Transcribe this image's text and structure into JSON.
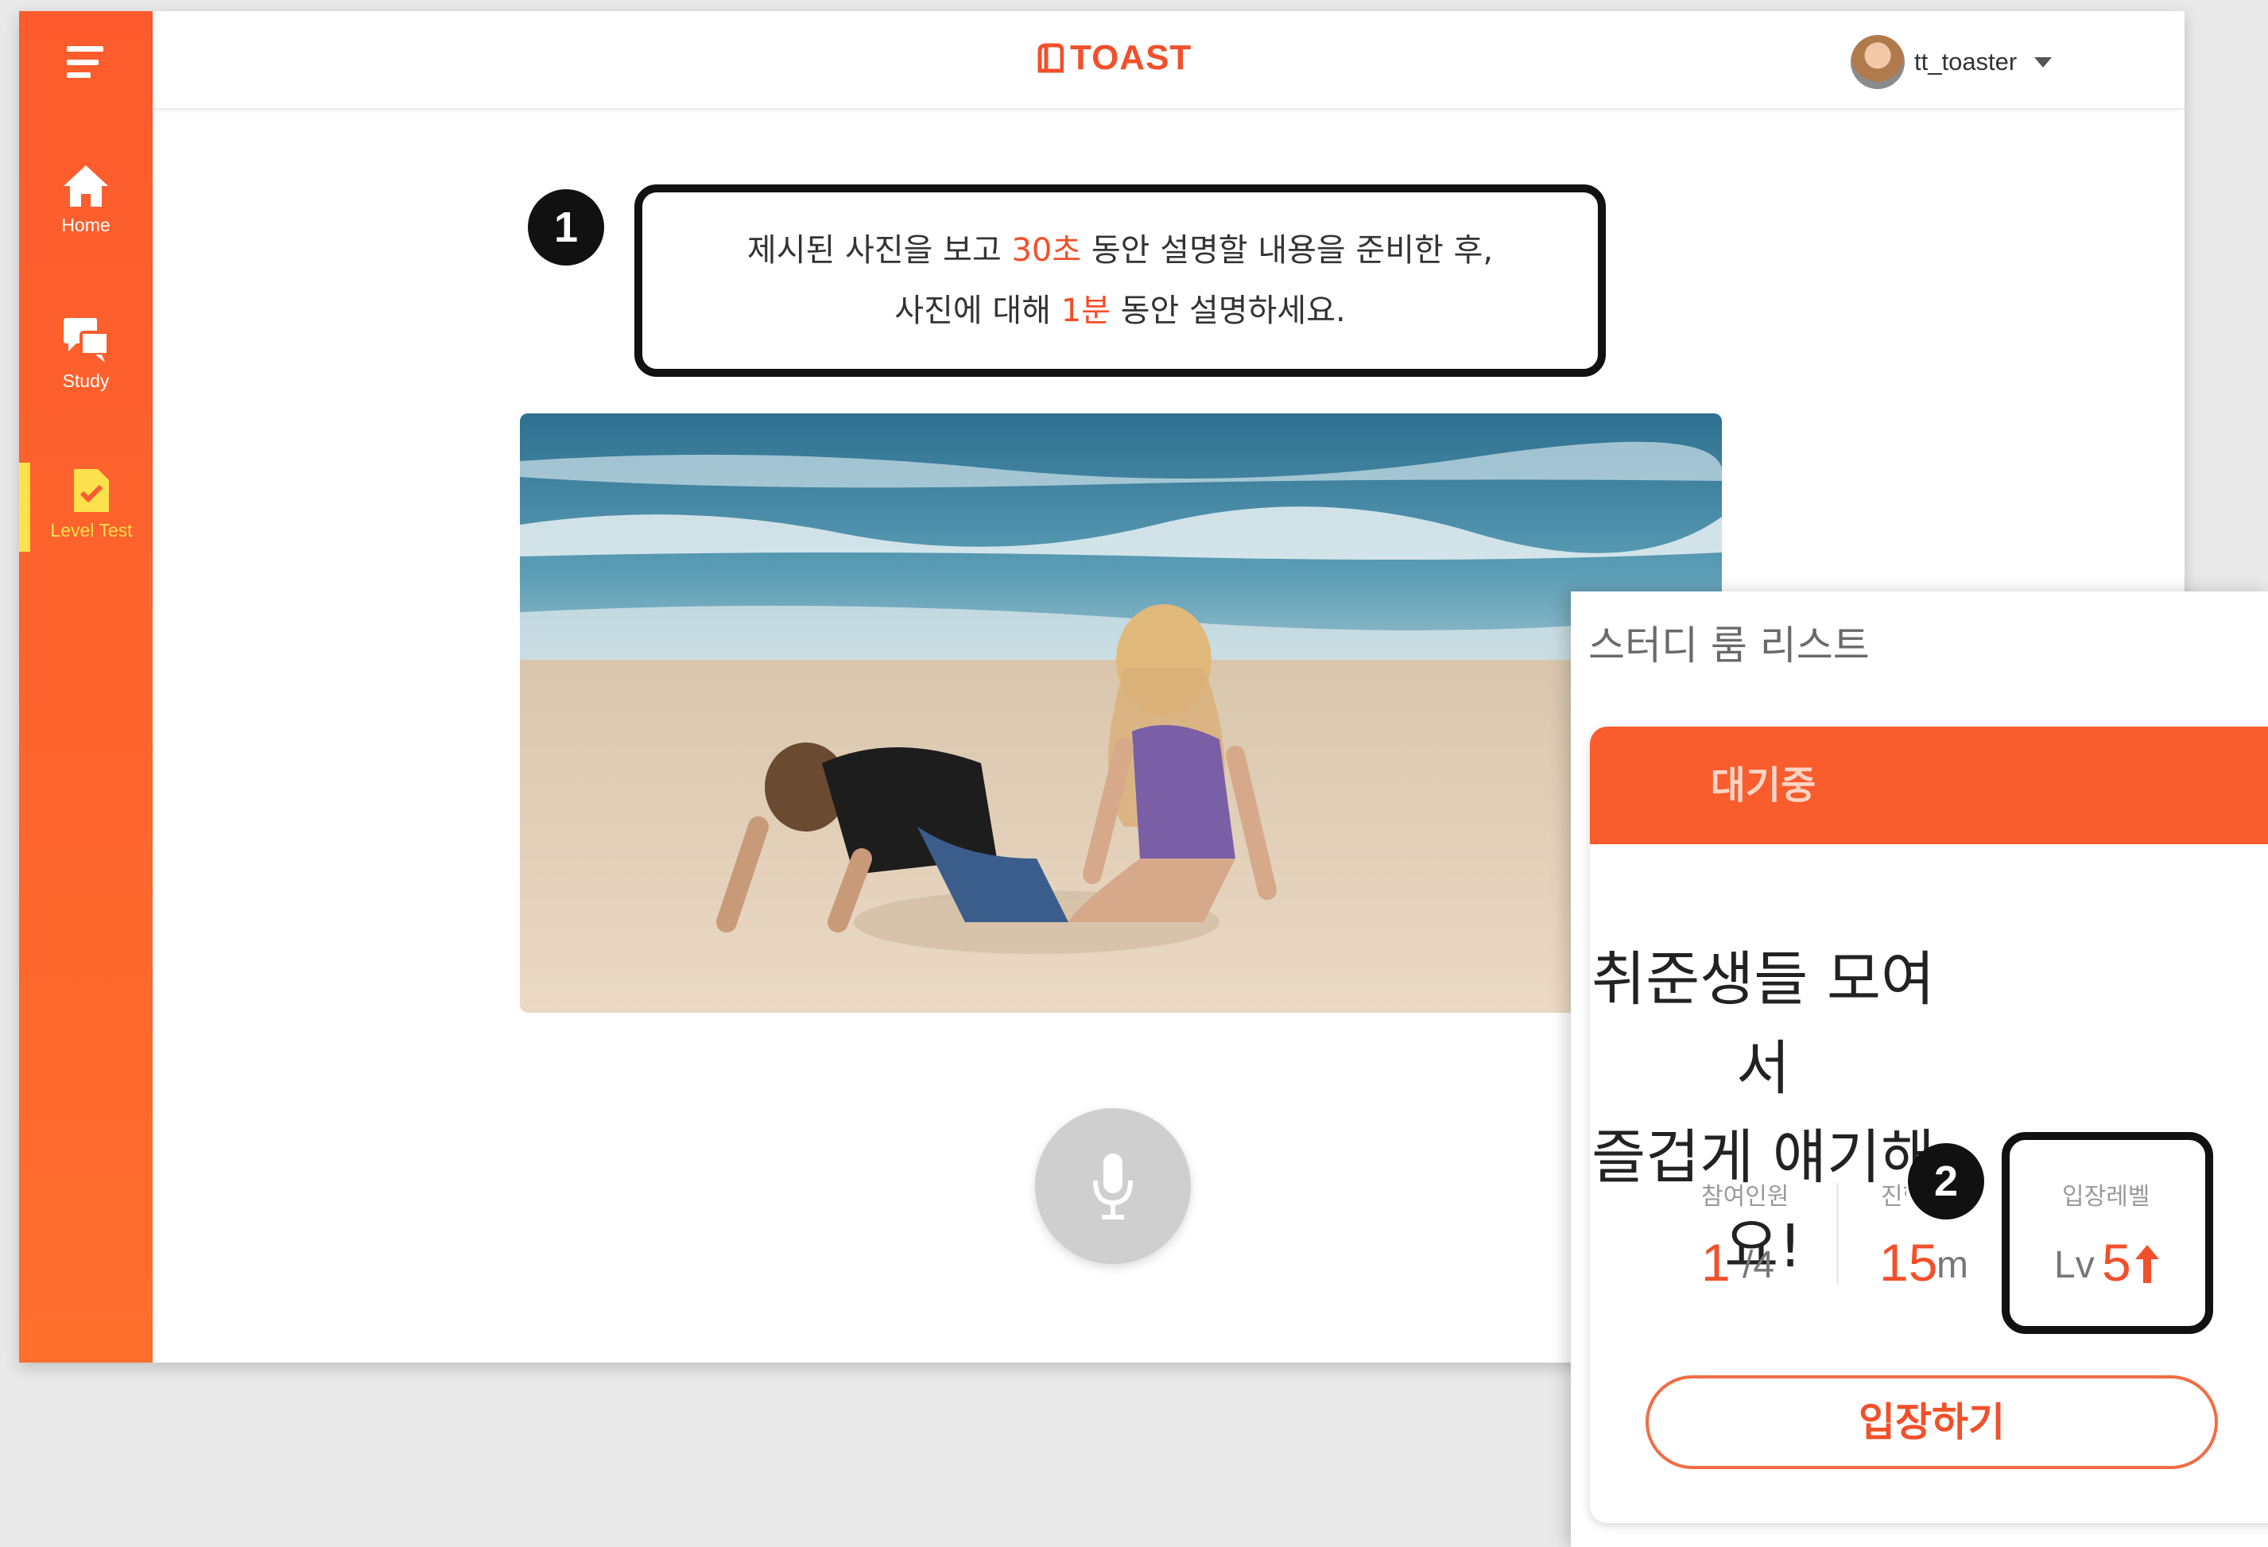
{
  "app": {
    "logo_text": "TOAST"
  },
  "sidebar": {
    "items": [
      {
        "label": "Home",
        "icon": "home-icon"
      },
      {
        "label": "Study",
        "icon": "chat-icon"
      },
      {
        "label": "Level Test",
        "icon": "clipboard-check-icon"
      }
    ]
  },
  "header": {
    "username": "tt_toaster"
  },
  "annotations": {
    "badge1": "1",
    "badge2": "2"
  },
  "instruction": {
    "line1_a": "제시된 사진을 보고 ",
    "line1_hl": "30초",
    "line1_b": " 동안 설명할 내용을 준비한 후,",
    "line2_a": "사진에 대해 ",
    "line2_hl": "1분",
    "line2_b": " 동안 설명하세요."
  },
  "study_panel": {
    "title": "스터디 룸 리스트",
    "status": "대기중",
    "room_title_line1": "취준생들 모여서",
    "room_title_line2": "즐겁게 얘기해요!",
    "participants_label": "참여인원",
    "participants_value": "1",
    "participants_max": "/4",
    "duration_label": "진행",
    "duration_value": "15",
    "duration_unit": "m",
    "level_label": "입장레벨",
    "level_prefix": "Lv",
    "level_value": "5",
    "enter_label": "입장하기"
  },
  "colors": {
    "accent": "#f2502a",
    "sidebar": "#fd5b2d",
    "highlight": "#ffe14d"
  }
}
